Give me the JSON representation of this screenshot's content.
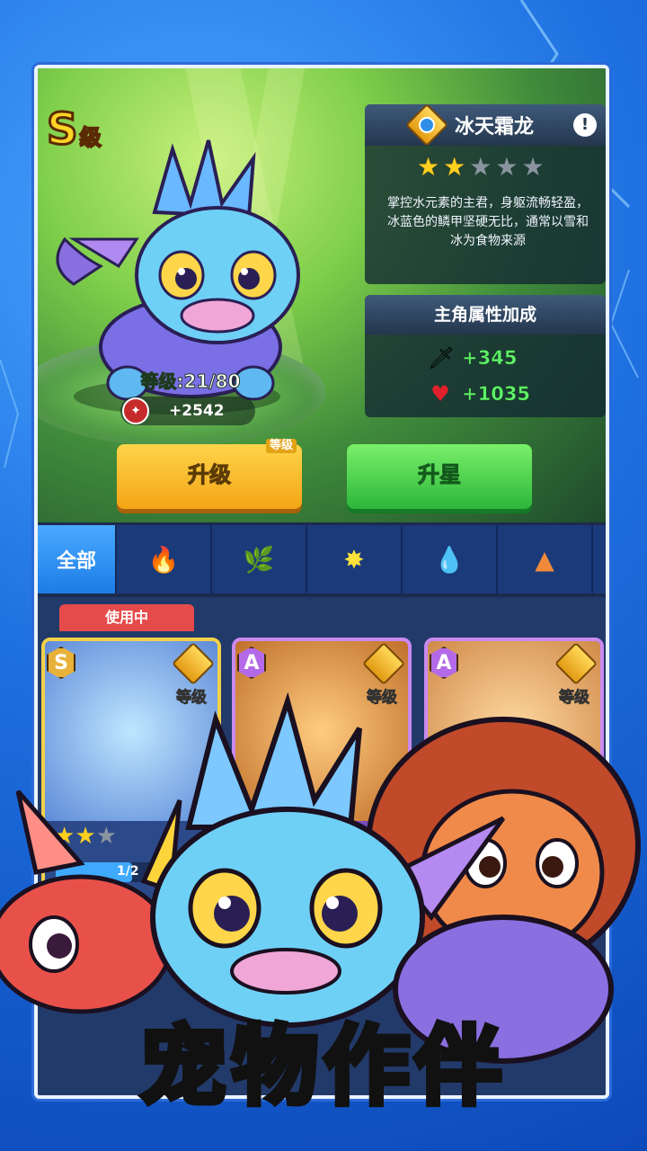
{
  "pet": {
    "grade_letter": "S",
    "grade_suffix": "级",
    "name": "冰天霜龙",
    "stars_filled": 2,
    "stars_total": 5,
    "description": "掌控水元素的主君，身躯流畅轻盈，冰蓝色的鳞甲坚硬无比，通常以雪和冰为食物来源",
    "level_text": "等级:21/80",
    "power": "+2542"
  },
  "bonus": {
    "title": "主角属性加成",
    "attack": "+345",
    "hp": "+1035"
  },
  "buttons": {
    "upgrade": "升级",
    "upgrade_tag": "等级",
    "star_up": "升星"
  },
  "tabs": {
    "all": "全部",
    "fire": "🔥",
    "nature": "🌿",
    "light": "✸",
    "water": "💧",
    "earth": "▲"
  },
  "cards": [
    {
      "tier": "S",
      "status": "使用中",
      "level_label": "等级",
      "stars_filled": 2,
      "progress": "1/2"
    },
    {
      "tier": "A",
      "level_label": "等级"
    },
    {
      "tier": "A",
      "level_label": "等级"
    }
  ],
  "slogan": "宠物作伴",
  "colors": {
    "background": "#1e6fe0",
    "upgrade_button": "#f3a415",
    "star_button": "#2cb63a",
    "bonus_text": "#5ff06a"
  }
}
